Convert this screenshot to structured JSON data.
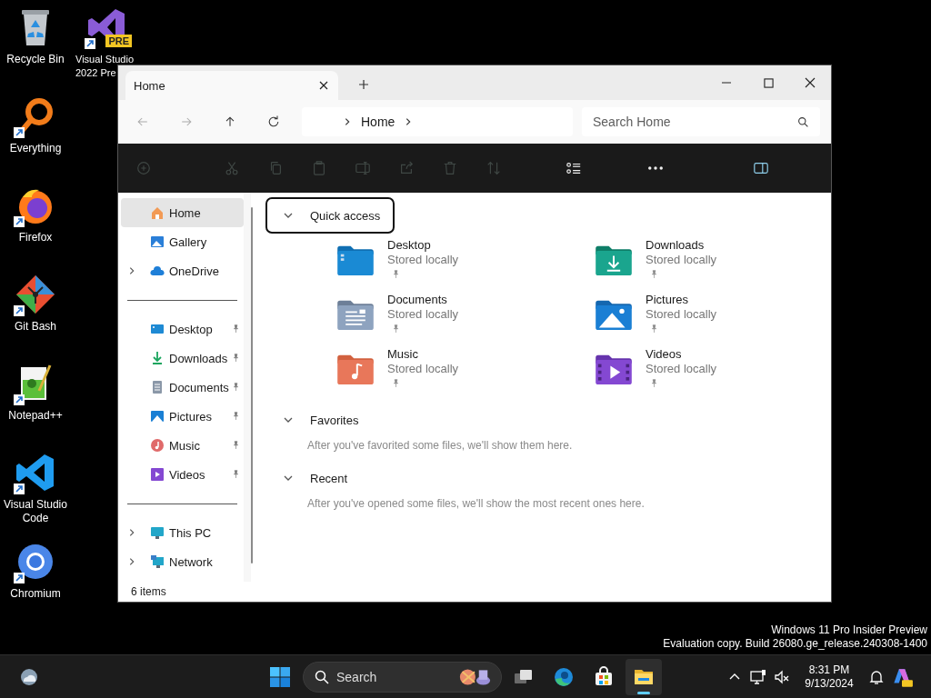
{
  "desktop": {
    "columns": [
      [
        {
          "kind": "recycle-bin",
          "label": [
            "Recycle Bin"
          ],
          "shortcut": false
        },
        {
          "kind": "everything",
          "label": [
            "Everything"
          ],
          "shortcut": true
        },
        {
          "kind": "firefox",
          "label": [
            "Firefox"
          ],
          "shortcut": true
        },
        {
          "kind": "git-bash",
          "label": [
            "Git Bash"
          ],
          "shortcut": true
        },
        {
          "kind": "notepad",
          "label": [
            "Notepad++"
          ],
          "shortcut": true
        },
        {
          "kind": "vscode",
          "label": [
            "Visual Studio",
            "Code"
          ],
          "shortcut": true
        },
        {
          "kind": "chromium",
          "label": [
            "Chromium"
          ],
          "shortcut": true
        }
      ],
      [
        {
          "kind": "visual-studio",
          "label": [
            "Visual Studio",
            "2022 Pre"
          ],
          "shortcut": true,
          "badge": "PRE"
        }
      ]
    ]
  },
  "explorer": {
    "tabs": [
      {
        "title": "Home",
        "selected": true
      }
    ],
    "address": {
      "crumbs": [
        "Home"
      ]
    },
    "search": {
      "placeholder": "Search Home"
    },
    "commands": [
      {
        "kind": "new",
        "disabled": true
      },
      {
        "kind": "cut",
        "disabled": true
      },
      {
        "kind": "copy",
        "disabled": true
      },
      {
        "kind": "paste",
        "disabled": true
      },
      {
        "kind": "rename",
        "disabled": true
      },
      {
        "kind": "share",
        "disabled": true
      },
      {
        "kind": "delete",
        "disabled": true
      },
      {
        "kind": "sort",
        "disabled": true
      },
      {
        "kind": "view",
        "disabled": false
      },
      {
        "kind": "more",
        "disabled": false
      },
      {
        "kind": "details",
        "disabled": false
      }
    ],
    "sidebar": {
      "groups": [
        [
          {
            "label": "Home",
            "kind": "home",
            "selected": true,
            "expandable": false,
            "pinned": false
          },
          {
            "label": "Gallery",
            "kind": "gallery",
            "selected": false,
            "expandable": false,
            "pinned": false
          },
          {
            "label": "OneDrive",
            "kind": "cloud",
            "selected": false,
            "expandable": true,
            "pinned": false
          }
        ],
        [
          {
            "label": "Desktop",
            "kind": "desktop",
            "selected": false,
            "expandable": false,
            "pinned": true
          },
          {
            "label": "Downloads",
            "kind": "downloads",
            "selected": false,
            "expandable": false,
            "pinned": true
          },
          {
            "label": "Documents",
            "kind": "documents",
            "selected": false,
            "expandable": false,
            "pinned": true
          },
          {
            "label": "Pictures",
            "kind": "pictures",
            "selected": false,
            "expandable": false,
            "pinned": true
          },
          {
            "label": "Music",
            "kind": "music",
            "selected": false,
            "expandable": false,
            "pinned": true
          },
          {
            "label": "Videos",
            "kind": "videos",
            "selected": false,
            "expandable": false,
            "pinned": true
          }
        ],
        [
          {
            "label": "This PC",
            "kind": "pc",
            "selected": false,
            "expandable": true,
            "pinned": false
          },
          {
            "label": "Network",
            "kind": "network",
            "selected": false,
            "expandable": true,
            "pinned": false
          }
        ]
      ]
    },
    "sections": [
      {
        "title": "Quick access",
        "expanded": true,
        "focused": true,
        "items": [
          {
            "name": "Desktop",
            "detail": "Stored locally",
            "kind": "desktop",
            "pinned": true
          },
          {
            "name": "Downloads",
            "detail": "Stored locally",
            "kind": "downloads",
            "pinned": true
          },
          {
            "name": "Documents",
            "detail": "Stored locally",
            "kind": "documents",
            "pinned": true
          },
          {
            "name": "Pictures",
            "detail": "Stored locally",
            "kind": "pictures",
            "pinned": true
          },
          {
            "name": "Music",
            "detail": "Stored locally",
            "kind": "music",
            "pinned": true
          },
          {
            "name": "Videos",
            "detail": "Stored locally",
            "kind": "videos",
            "pinned": true
          }
        ]
      },
      {
        "title": "Favorites",
        "expanded": true,
        "focused": false,
        "message": "After you've favorited some files, we'll show them here."
      },
      {
        "title": "Recent",
        "expanded": true,
        "focused": false,
        "message": "After you've opened some files, we'll show the most recent ones here."
      }
    ],
    "status": "6 items"
  },
  "notice": [
    "Windows 11 Pro Insider Preview",
    "Evaluation copy. Build 26080.ge_release.240308-1400"
  ],
  "taskbar": {
    "search": {
      "label": "Search"
    },
    "apps": [
      {
        "kind": "task-view",
        "active": false
      },
      {
        "kind": "edge",
        "active": false
      },
      {
        "kind": "store",
        "active": false
      },
      {
        "kind": "explorer",
        "active": true
      }
    ],
    "clock": {
      "time": "8:31 PM",
      "date": "9/13/2024"
    }
  }
}
